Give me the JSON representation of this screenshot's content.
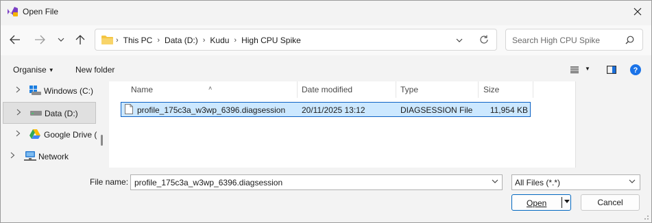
{
  "window": {
    "title": "Open File"
  },
  "nav": {
    "breadcrumbs": [
      "This PC",
      "Data (D:)",
      "Kudu",
      "High CPU Spike"
    ],
    "search_placeholder": "Search High CPU Spike"
  },
  "commands": {
    "organise": "Organise",
    "new_folder": "New folder"
  },
  "tree": {
    "items": [
      {
        "label": "Windows (C:)",
        "icon": "drive-windows-icon"
      },
      {
        "label": "Data (D:)",
        "icon": "drive-icon",
        "selected": true
      },
      {
        "label": "Google Drive (",
        "icon": "google-drive-icon"
      },
      {
        "label": "Network",
        "icon": "network-icon"
      }
    ]
  },
  "columns": {
    "name": "Name",
    "date": "Date modified",
    "type": "Type",
    "size": "Size"
  },
  "files": [
    {
      "name": "profile_175c3a_w3wp_6396.diagsession",
      "date": "20/11/2025 13:12",
      "type": "DIAGSESSION File",
      "size": "11,954 KB"
    }
  ],
  "bottom": {
    "file_name_label": "File name:",
    "file_name_value": "profile_175c3a_w3wp_6396.diagsession",
    "file_type": "All Files (*.*)",
    "open_label": "Open",
    "cancel_label": "Cancel"
  },
  "colors": {
    "selection_bg": "#cce8ff",
    "selection_border": "#0a60c4",
    "accent": "#0067c0",
    "help": "#1a73e8"
  }
}
